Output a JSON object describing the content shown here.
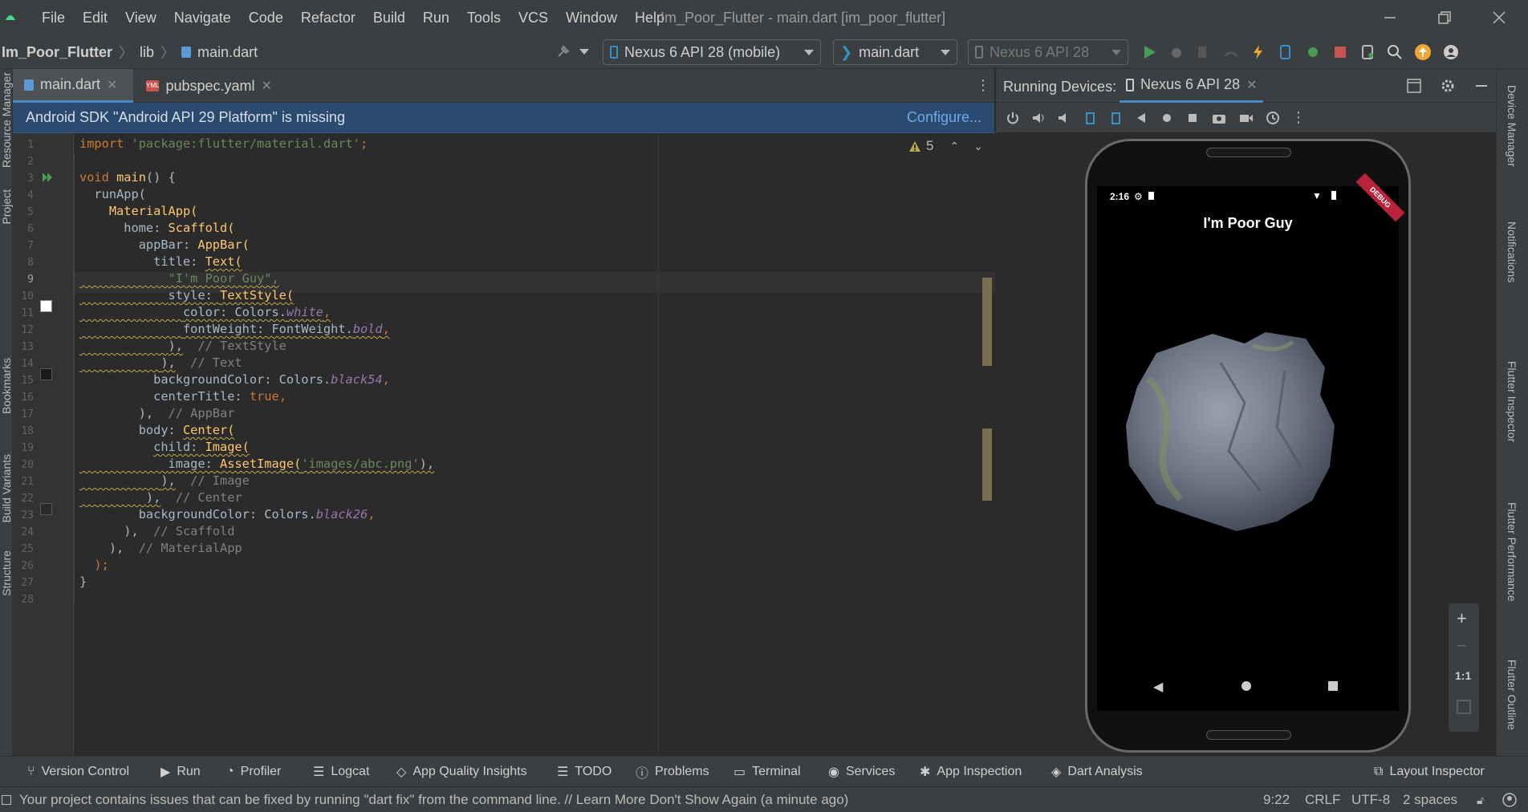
{
  "app": {
    "window_title": "Im_Poor_Flutter - main.dart [im_poor_flutter]",
    "menu": [
      "File",
      "Edit",
      "View",
      "Navigate",
      "Code",
      "Refactor",
      "Build",
      "Run",
      "Tools",
      "VCS",
      "Window",
      "Help"
    ]
  },
  "nav": {
    "breadcrumb": [
      "Im_Poor_Flutter",
      "lib",
      "main.dart"
    ],
    "device_selector": "Nexus 6 API 28 (mobile)",
    "run_config": "main.dart",
    "target_device": "Nexus 6 API 28"
  },
  "tabs": [
    {
      "label": "main.dart",
      "active": true
    },
    {
      "label": "pubspec.yaml",
      "active": false
    }
  ],
  "banner": {
    "message": "Android SDK \"Android API 29 Platform\" is missing",
    "action": "Configure..."
  },
  "editor": {
    "warnings_count": "5",
    "current_line": 9,
    "lines": [
      "1",
      "2",
      "3",
      "4",
      "5",
      "6",
      "7",
      "8",
      "9",
      "10",
      "11",
      "12",
      "13",
      "14",
      "15",
      "16",
      "17",
      "18",
      "19",
      "20",
      "21",
      "22",
      "23",
      "24",
      "25",
      "26",
      "27",
      "28"
    ],
    "code": {
      "l1_import": "import",
      "l1_str": "'package:flutter/material.dart'",
      "l1_end": ";",
      "l3_void": "void",
      "l3_main": "main",
      "l3_rest": "() {",
      "l4": "runApp(",
      "l5": "MaterialApp(",
      "l6_key": "home: ",
      "l6_val": "Scaffold(",
      "l7_key": "appBar: ",
      "l7_val": "AppBar(",
      "l8_key": "title: ",
      "l8_val": "Text(",
      "l9": "\"I'm Poor Guy\",",
      "l10_key": "style: ",
      "l10_val": "TextStyle(",
      "l11_key": "color: Colors.",
      "l11_val": "white",
      "l11_end": ",",
      "l12_key": "fontWeight: FontWeight.",
      "l12_val": "bold",
      "l12_end": ",",
      "l13_code": "),",
      "l13_cmt": "// TextStyle",
      "l14_code": "),",
      "l14_cmt": "// Text",
      "l15_key": "backgroundColor: Colors.",
      "l15_val": "black54",
      "l15_end": ",",
      "l16_key": "centerTitle: ",
      "l16_val": "true",
      "l16_end": ",",
      "l17_code": "),",
      "l17_cmt": "// AppBar",
      "l18_key": "body: ",
      "l18_val": "Center(",
      "l19_key": "child: ",
      "l19_val": "Image(",
      "l20_key": "image: ",
      "l20_val": "AssetImage(",
      "l20_str": "'images/abc.png'",
      "l20_end": "),",
      "l21_code": "),",
      "l21_cmt": "// Image",
      "l22_code": "),",
      "l22_cmt": "// Center",
      "l23_key": "backgroundColor: Colors.",
      "l23_val": "black26",
      "l23_end": ",",
      "l24_code": "),",
      "l24_cmt": "// Scaffold",
      "l25_code": "),",
      "l25_cmt": "// MaterialApp",
      "l26": ");",
      "l27": "}"
    }
  },
  "running_devices": {
    "label": "Running Devices:",
    "tab": "Nexus 6 API 28",
    "phone": {
      "time": "2:16",
      "appbar_title": "I'm Poor Guy",
      "debug_ribbon": "DEBUG"
    },
    "zoom_reset": "1:1"
  },
  "right_strip": [
    "Device Manager",
    "Notifications",
    "Flutter Inspector",
    "Flutter Performance",
    "Flutter Outline"
  ],
  "left_strip": [
    "Resource Manager",
    "Project",
    "Bookmarks",
    "Build Variants",
    "Structure"
  ],
  "tool_windows": [
    "Version Control",
    "Run",
    "Profiler",
    "Logcat",
    "App Quality Insights",
    "TODO",
    "Problems",
    "Terminal",
    "Services",
    "App Inspection",
    "Dart Analysis",
    "Layout Inspector"
  ],
  "status": {
    "message": "Your project contains issues that can be fixed by running \"dart fix\" from the command line. // Learn More  Don't Show Again (a minute ago)",
    "position": "9:22",
    "line_sep": "CRLF",
    "encoding": "UTF-8",
    "indent": "2 spaces"
  },
  "colors": {
    "accent": "#4a88c7",
    "banner_bg": "#2b4a6f",
    "keyword": "#cc7832",
    "function": "#ffc66d",
    "string": "#6a8759",
    "comment": "#808080",
    "constant": "#9876aa"
  }
}
